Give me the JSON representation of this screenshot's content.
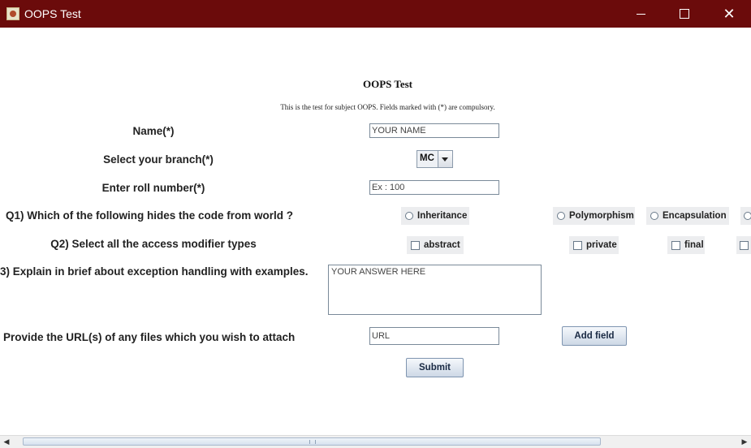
{
  "window": {
    "title": "OOPS Test"
  },
  "form": {
    "heading": "OOPS Test",
    "subheading": "This is the test for subject OOPS. Fields marked with (*) are compulsory.",
    "name_label": "Name(*)",
    "name_value": "YOUR NAME",
    "branch_label": "Select your branch(*)",
    "branch_selected": "MC",
    "roll_label": "Enter roll number(*)",
    "roll_value": "Ex : 100",
    "q1": {
      "label": "Q1) Which of the following hides the code from world ?",
      "options": [
        "Inheritance",
        "Polymorphism",
        "Encapsulation"
      ]
    },
    "q2": {
      "label": "Q2) Select all the access modifier types",
      "options": [
        "abstract",
        "private",
        "final"
      ]
    },
    "q3": {
      "label": "3) Explain in brief about exception handling with examples.",
      "value": "YOUR ANSWER HERE"
    },
    "url_label": "Provide the URL(s) of any files which you wish to attach",
    "url_value": "URL",
    "add_field_label": "Add field",
    "submit_label": "Submit"
  }
}
